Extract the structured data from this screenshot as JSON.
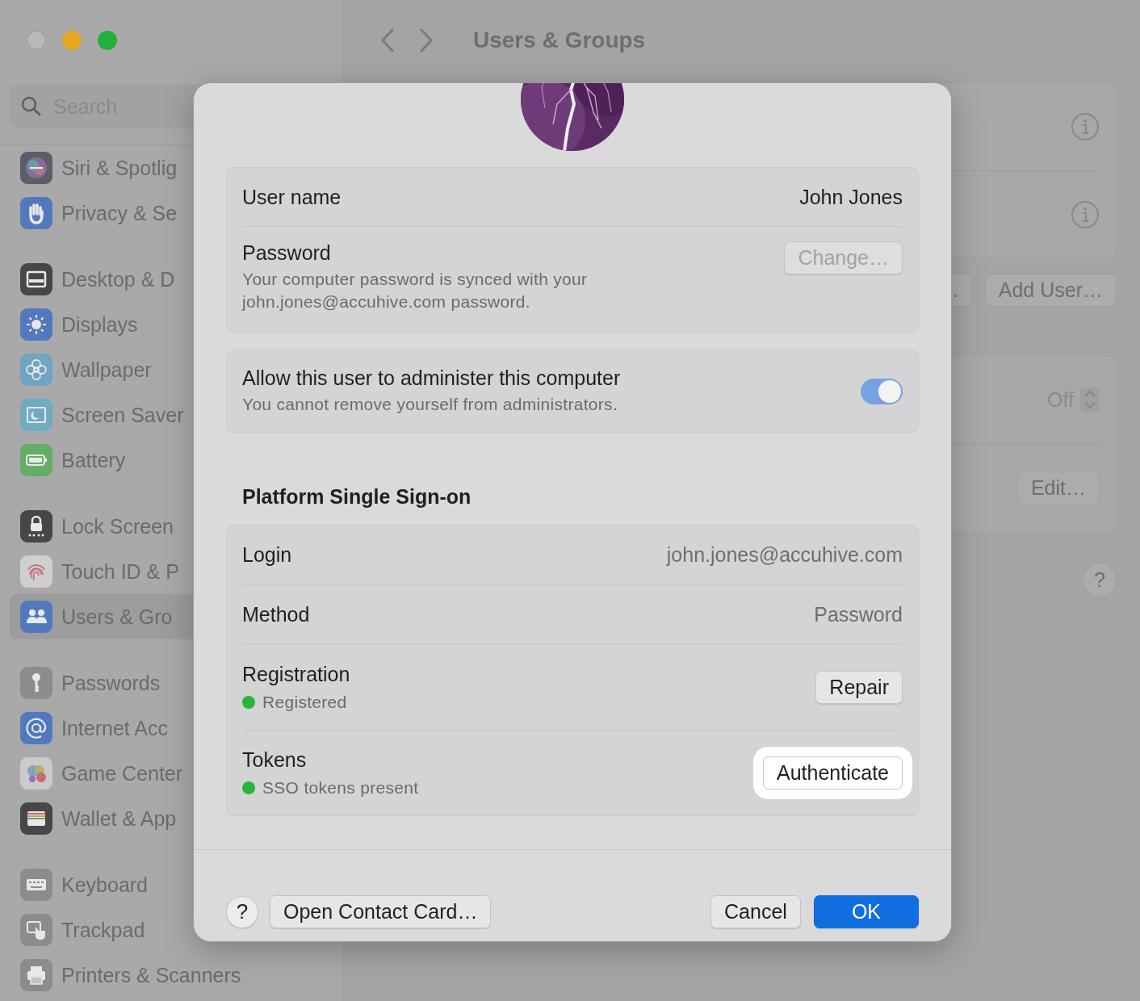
{
  "sidebar": {
    "search": {
      "placeholder": "Search"
    },
    "groups": [
      [
        {
          "label": "Siri & Spotlig",
          "selected": false
        },
        {
          "label": "Privacy & Se",
          "selected": false
        }
      ],
      [
        {
          "label": "Desktop & D",
          "selected": false
        },
        {
          "label": "Displays",
          "selected": false
        },
        {
          "label": "Wallpaper",
          "selected": false
        },
        {
          "label": "Screen Saver",
          "selected": false
        },
        {
          "label": "Battery",
          "selected": false
        }
      ],
      [
        {
          "label": "Lock Screen",
          "selected": false
        },
        {
          "label": "Touch ID & P",
          "selected": false
        },
        {
          "label": "Users & Gro",
          "selected": true
        }
      ],
      [
        {
          "label": "Passwords",
          "selected": false
        },
        {
          "label": "Internet Acc",
          "selected": false
        },
        {
          "label": "Game Center",
          "selected": false
        },
        {
          "label": "Wallet & App",
          "selected": false
        }
      ],
      [
        {
          "label": "Keyboard",
          "selected": false
        },
        {
          "label": "Trackpad",
          "selected": false
        },
        {
          "label": "Printers & Scanners",
          "selected": false
        }
      ]
    ]
  },
  "header": {
    "title": "Users & Groups"
  },
  "main": {
    "user_rows": [
      {
        "kind": "info"
      },
      {
        "kind": "info"
      }
    ],
    "buttons": [
      ".",
      "Add User…"
    ],
    "settings_rows": [
      {
        "kind": "popup",
        "value": "Off"
      },
      {
        "kind": "button",
        "label": "Edit…"
      }
    ],
    "help": "?"
  },
  "dialog": {
    "user_name": {
      "label": "User name",
      "value": "John Jones"
    },
    "password": {
      "label": "Password",
      "description": "Your computer password is synced with your john.jones@accuhive.com password.",
      "button": {
        "label": "Change…",
        "disabled": true
      }
    },
    "admin": {
      "label": "Allow this user to administer this computer",
      "description": "You cannot remove yourself from administrators.",
      "on": true
    },
    "sso": {
      "heading": "Platform Single Sign-on",
      "rows": [
        {
          "kind": "value",
          "label": "Login",
          "value": "john.jones@accuhive.com"
        },
        {
          "kind": "value",
          "label": "Method",
          "value": "Password"
        },
        {
          "kind": "status",
          "label": "Registration",
          "status": "Registered",
          "color": "#28b43c",
          "button": {
            "label": "Repair",
            "focused": false
          }
        },
        {
          "kind": "status",
          "label": "Tokens",
          "status": "SSO tokens present",
          "color": "#28b43c",
          "button": {
            "label": "Authenticate",
            "focused": true
          }
        }
      ]
    },
    "footer": {
      "help": "?",
      "left_buttons": [
        {
          "label": "Open Contact Card…"
        }
      ],
      "right_buttons": [
        {
          "label": "Cancel",
          "kind": "secondary"
        },
        {
          "label": "OK",
          "kind": "primary"
        }
      ]
    }
  }
}
